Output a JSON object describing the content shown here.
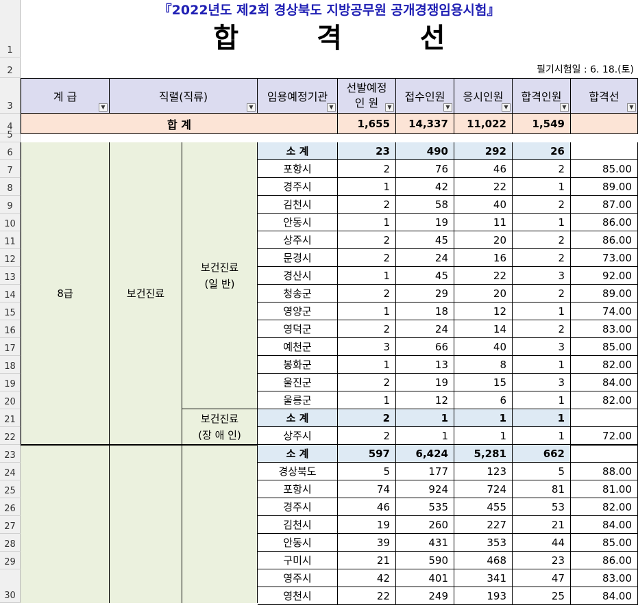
{
  "title": "『2022년도 제2회 경상북도 지방공무원 공개경쟁임용시험』",
  "heading": "합 격 선",
  "exam_date": "필기시험일 : 6. 18.(토)",
  "row_numbers": [
    "1",
    "2",
    "3",
    "4",
    "5",
    "6",
    "7",
    "8",
    "9",
    "10",
    "11",
    "12",
    "13",
    "14",
    "15",
    "16",
    "17",
    "18",
    "19",
    "20",
    "21",
    "22",
    "23",
    "24",
    "25",
    "26",
    "27",
    "28",
    "29",
    "30"
  ],
  "headers": {
    "grade": "계  급",
    "series": "직렬(직류)",
    "agency": "임용예정기관",
    "planned_line1": "선발예정",
    "planned_line2": "인      원",
    "applied": "접수인원",
    "tested": "응시인원",
    "passed": "합격인원",
    "cutoff": "합격선"
  },
  "total": {
    "label": "합          계",
    "planned": "1,655",
    "applied": "14,337",
    "tested": "11,022",
    "passed": "1,549"
  },
  "group1": {
    "grade": "8급",
    "series": "보건진료",
    "sub1_line1": "보건진료",
    "sub1_line2": "(일       반)",
    "sub2_line1": "보건진료",
    "sub2_line2": "(장 애 인)"
  },
  "subtotal_label": "소   계",
  "rows": [
    {
      "agency": "소   계",
      "planned": "23",
      "applied": "490",
      "tested": "292",
      "passed": "26",
      "cutoff": "",
      "sub": true
    },
    {
      "agency": "포항시",
      "planned": "2",
      "applied": "76",
      "tested": "46",
      "passed": "2",
      "cutoff": "85.00"
    },
    {
      "agency": "경주시",
      "planned": "1",
      "applied": "42",
      "tested": "22",
      "passed": "1",
      "cutoff": "89.00"
    },
    {
      "agency": "김천시",
      "planned": "2",
      "applied": "58",
      "tested": "40",
      "passed": "2",
      "cutoff": "87.00"
    },
    {
      "agency": "안동시",
      "planned": "1",
      "applied": "19",
      "tested": "11",
      "passed": "1",
      "cutoff": "86.00"
    },
    {
      "agency": "상주시",
      "planned": "2",
      "applied": "45",
      "tested": "20",
      "passed": "2",
      "cutoff": "86.00"
    },
    {
      "agency": "문경시",
      "planned": "2",
      "applied": "24",
      "tested": "16",
      "passed": "2",
      "cutoff": "73.00"
    },
    {
      "agency": "경산시",
      "planned": "1",
      "applied": "45",
      "tested": "22",
      "passed": "3",
      "cutoff": "92.00"
    },
    {
      "agency": "청송군",
      "planned": "2",
      "applied": "29",
      "tested": "20",
      "passed": "2",
      "cutoff": "89.00"
    },
    {
      "agency": "영양군",
      "planned": "1",
      "applied": "18",
      "tested": "12",
      "passed": "1",
      "cutoff": "74.00"
    },
    {
      "agency": "영덕군",
      "planned": "2",
      "applied": "24",
      "tested": "14",
      "passed": "2",
      "cutoff": "83.00"
    },
    {
      "agency": "예천군",
      "planned": "3",
      "applied": "66",
      "tested": "40",
      "passed": "3",
      "cutoff": "85.00"
    },
    {
      "agency": "봉화군",
      "planned": "1",
      "applied": "13",
      "tested": "8",
      "passed": "1",
      "cutoff": "82.00"
    },
    {
      "agency": "울진군",
      "planned": "2",
      "applied": "19",
      "tested": "15",
      "passed": "3",
      "cutoff": "84.00"
    },
    {
      "agency": "울릉군",
      "planned": "1",
      "applied": "12",
      "tested": "6",
      "passed": "1",
      "cutoff": "82.00"
    },
    {
      "agency": "소   계",
      "planned": "2",
      "applied": "1",
      "tested": "1",
      "passed": "1",
      "cutoff": "",
      "sub": true
    },
    {
      "agency": "상주시",
      "planned": "2",
      "applied": "1",
      "tested": "1",
      "passed": "1",
      "cutoff": "72.00"
    },
    {
      "agency": "소   계",
      "planned": "597",
      "applied": "6,424",
      "tested": "5,281",
      "passed": "662",
      "cutoff": "",
      "sub": true
    },
    {
      "agency": "경상북도",
      "planned": "5",
      "applied": "177",
      "tested": "123",
      "passed": "5",
      "cutoff": "88.00"
    },
    {
      "agency": "포항시",
      "planned": "74",
      "applied": "924",
      "tested": "724",
      "passed": "81",
      "cutoff": "81.00"
    },
    {
      "agency": "경주시",
      "planned": "46",
      "applied": "535",
      "tested": "455",
      "passed": "53",
      "cutoff": "82.00"
    },
    {
      "agency": "김천시",
      "planned": "19",
      "applied": "260",
      "tested": "227",
      "passed": "21",
      "cutoff": "84.00"
    },
    {
      "agency": "안동시",
      "planned": "39",
      "applied": "431",
      "tested": "353",
      "passed": "44",
      "cutoff": "85.00"
    },
    {
      "agency": "구미시",
      "planned": "21",
      "applied": "590",
      "tested": "468",
      "passed": "23",
      "cutoff": "86.00"
    },
    {
      "agency": "영주시",
      "planned": "42",
      "applied": "401",
      "tested": "341",
      "passed": "47",
      "cutoff": "83.00"
    },
    {
      "agency": "영천시",
      "planned": "22",
      "applied": "249",
      "tested": "193",
      "passed": "25",
      "cutoff": "84.00"
    }
  ]
}
